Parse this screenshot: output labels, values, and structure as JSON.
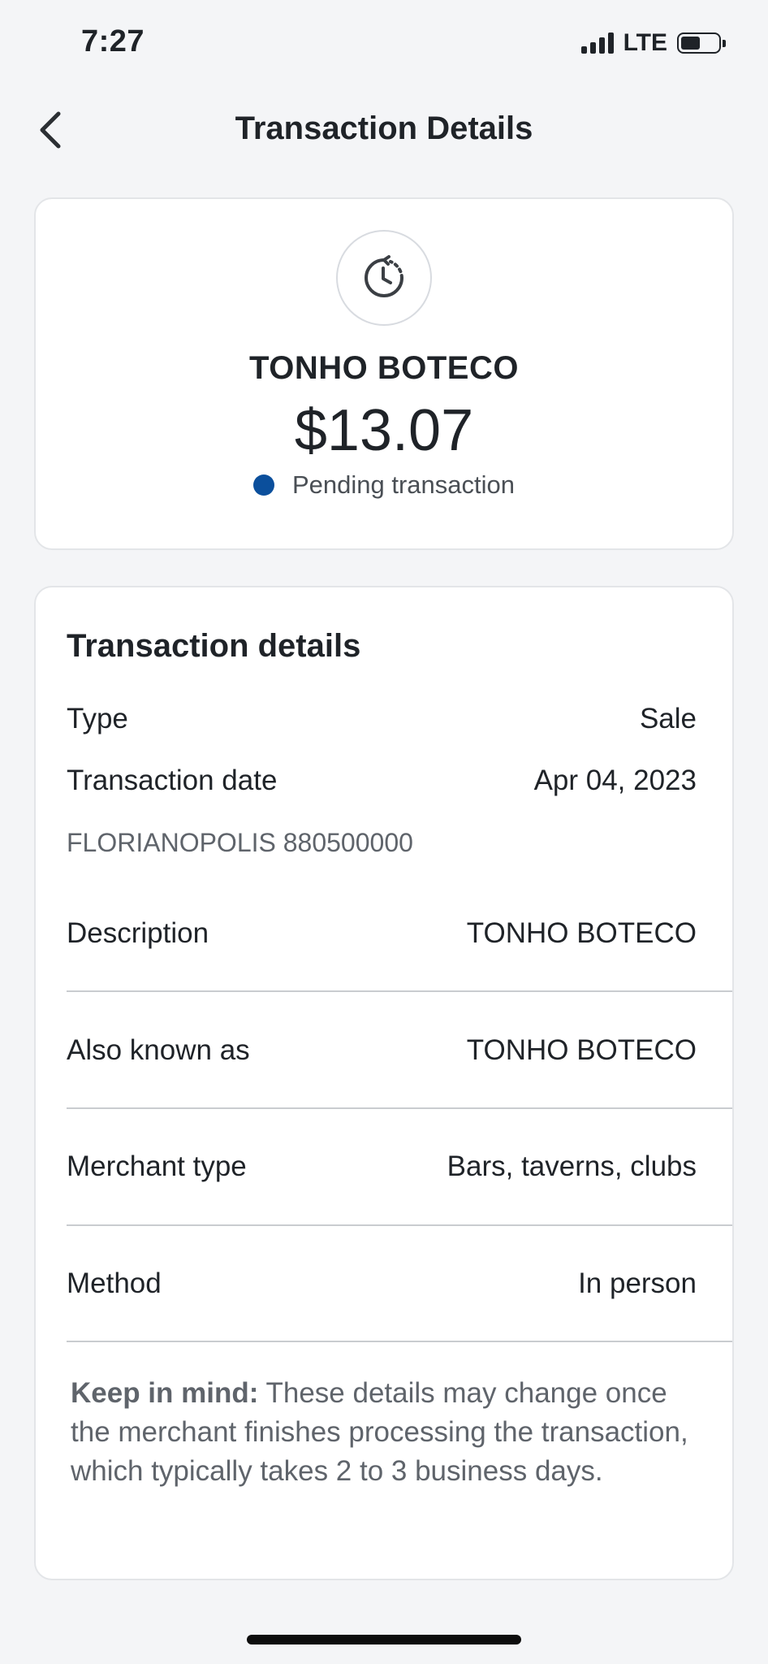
{
  "status_bar": {
    "time": "7:27",
    "network": "LTE",
    "signal_bars": 4,
    "battery_level": 0.45
  },
  "header": {
    "title": "Transaction Details",
    "back_icon": "chevron-left-icon"
  },
  "summary": {
    "icon": "pending-clock-icon",
    "merchant": "TONHO BOTECO",
    "amount": "$13.07",
    "status": "Pending transaction",
    "status_color": "#0b4f9c"
  },
  "details": {
    "title": "Transaction details",
    "type_label": "Type",
    "type_value": "Sale",
    "date_label": "Transaction date",
    "date_value": "Apr 04, 2023",
    "location": "FLORIANOPOLIS 880500000",
    "description_label": "Description",
    "description_value": "TONHO BOTECO",
    "aka_label": "Also known as",
    "aka_value": "TONHO BOTECO",
    "merchant_type_label": "Merchant type",
    "merchant_type_value": "Bars, taverns, clubs",
    "method_label": "Method",
    "method_value": "In person"
  },
  "note": {
    "heading": "Keep in mind:",
    "text": " These details may change once the merchant finishes processing the transaction, which typically takes 2 to 3 business days."
  }
}
